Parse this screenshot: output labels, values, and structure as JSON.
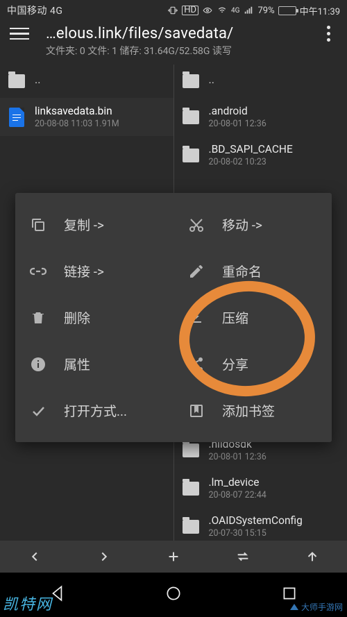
{
  "status": {
    "carrier": "中国移动 4G",
    "hd": "HD",
    "net_small": "4G",
    "battery_pct": "79%",
    "battery_fill_pct": 79,
    "time": "中午11:39"
  },
  "header": {
    "title": "…elous.link/files/savedata/",
    "subtitle": "文件夹: 0  文件: 1  储存: 31.64G/52.58G  读写"
  },
  "left_pane": {
    "up": "..",
    "items": [
      {
        "name": "linksavedata.bin",
        "meta": "20-08-08 11:03  1.91M",
        "type": "file",
        "selected": true
      }
    ]
  },
  "right_pane": {
    "up": "..",
    "items": [
      {
        "name": ".android",
        "meta": "20-08-01 12:36",
        "type": "folder"
      },
      {
        "name": ".BD_SAPI_CACHE",
        "meta": "20-08-02 10:23",
        "type": "folder"
      },
      {
        "name": ".hiidosdk",
        "meta": "20-08-01 12:36",
        "type": "folder"
      },
      {
        "name": ".lm_device",
        "meta": "20-08-07 22:44",
        "type": "folder"
      },
      {
        "name": ".OAIDSystemConfig",
        "meta": "20-07-30 15:15",
        "type": "folder"
      }
    ]
  },
  "context_menu": [
    {
      "icon": "copy-icon",
      "label": "复制 ->"
    },
    {
      "icon": "cut-icon",
      "label": "移动 ->"
    },
    {
      "icon": "link-icon",
      "label": "链接 ->"
    },
    {
      "icon": "rename-icon",
      "label": "重命名"
    },
    {
      "icon": "delete-icon",
      "label": "删除"
    },
    {
      "icon": "compress-icon",
      "label": "压缩"
    },
    {
      "icon": "info-icon",
      "label": "属性"
    },
    {
      "icon": "share-icon",
      "label": "分享"
    },
    {
      "icon": "openwith-icon",
      "label": "打开方式..."
    },
    {
      "icon": "bookmark-icon",
      "label": "添加书签"
    }
  ],
  "toolbar": {
    "back": "back-icon",
    "forward": "forward-icon",
    "add": "add-icon",
    "swap": "swap-icon",
    "up": "up-icon"
  },
  "watermarks": {
    "left": "凯特网",
    "right": "大师手游网"
  }
}
